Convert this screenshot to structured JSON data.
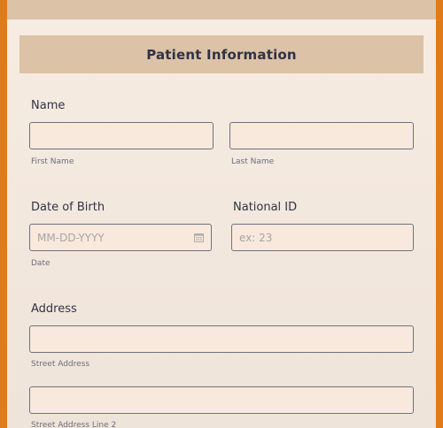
{
  "section": {
    "title": "Patient Information"
  },
  "name": {
    "label": "Name",
    "first_sublabel": "First Name",
    "last_sublabel": "Last Name",
    "first_value": "",
    "last_value": ""
  },
  "dob": {
    "label": "Date of Birth",
    "placeholder": "MM-DD-YYYY",
    "sublabel": "Date"
  },
  "national_id": {
    "label": "National ID",
    "placeholder": "ex: 23"
  },
  "address": {
    "label": "Address",
    "line1_sublabel": "Street Address",
    "line2_sublabel": "Street Address Line 2",
    "line1_value": "",
    "line2_value": ""
  },
  "colors": {
    "frame": "#e07b1a",
    "header_bg": "#dcc2a6",
    "input_bg": "#f8e9dc"
  }
}
